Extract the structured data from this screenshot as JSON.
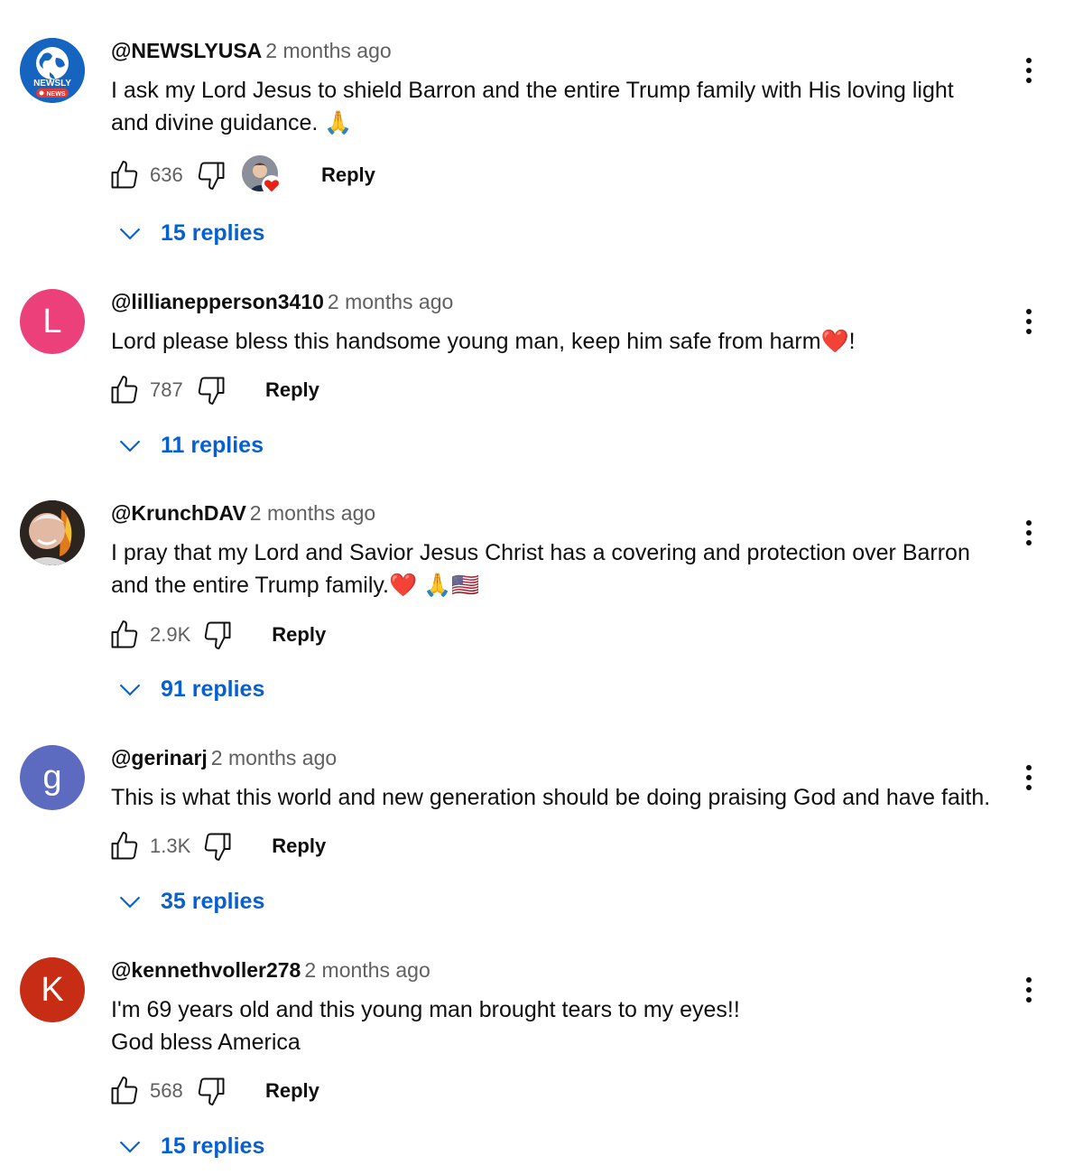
{
  "comments": [
    {
      "author": "@NEWSLYUSA",
      "time": "2 months ago",
      "lines": [
        "I ask my Lord Jesus to shield Barron and the entire Trump family with His loving light",
        "and divine guidance. 🙏"
      ],
      "likes": "636",
      "reply_label": "Reply",
      "replies_label": "15 replies",
      "avatar": {
        "type": "logo",
        "logo_text": "NEWSLY",
        "logo_sub": "NEWS",
        "color": "#1565c0"
      },
      "creator_heart": true
    },
    {
      "author": "@lillianepperson3410",
      "time": "2 months ago",
      "lines": [
        "Lord please bless this handsome young man, keep him safe from harm❤️!"
      ],
      "likes": "787",
      "reply_label": "Reply",
      "replies_label": "11 replies",
      "avatar": {
        "type": "letter",
        "letter": "L",
        "color": "#ec407a"
      }
    },
    {
      "author": "@KrunchDAV",
      "time": "2 months ago",
      "lines": [
        "I pray that my Lord and Savior Jesus Christ has a covering and protection over Barron",
        "and the entire Trump family.❤️ 🙏🇺🇸"
      ],
      "likes": "2.9K",
      "reply_label": "Reply",
      "replies_label": "91 replies",
      "avatar": {
        "type": "photo"
      }
    },
    {
      "author": "@gerinarj",
      "time": "2 months ago",
      "lines": [
        "This is what this world and new generation should be doing praising God and have faith."
      ],
      "likes": "1.3K",
      "reply_label": "Reply",
      "replies_label": "35 replies",
      "avatar": {
        "type": "letter",
        "letter": "g",
        "color": "#5c6bc0"
      }
    },
    {
      "author": "@kennethvoller278",
      "time": "2 months ago",
      "lines": [
        "I'm 69 years old and this young man brought tears to my eyes!!",
        "God bless America"
      ],
      "likes": "568",
      "reply_label": "Reply",
      "replies_label": "15 replies",
      "avatar": {
        "type": "letter",
        "letter": "K",
        "color": "#c62d14"
      }
    }
  ]
}
